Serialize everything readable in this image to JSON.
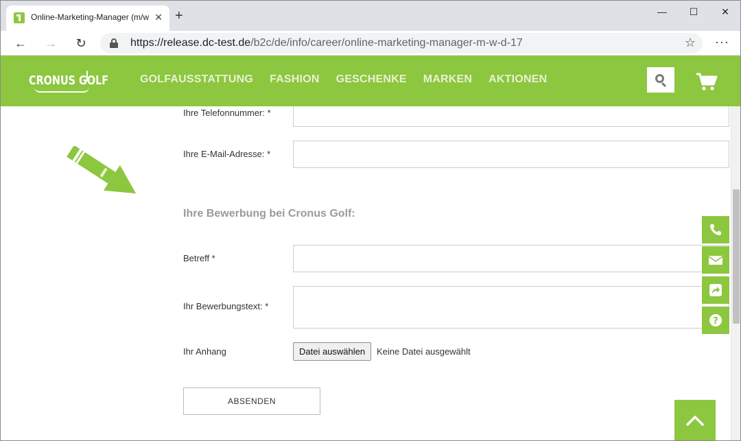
{
  "browser": {
    "tab_title": "Online-Marketing-Manager (m/w",
    "tab_close": "✕",
    "new_tab": "+",
    "url_host": "https://release.dc-test.de",
    "url_path": "/b2c/de/info/career/online-marketing-manager-m-w-d-17",
    "window_minimize": "—",
    "window_maximize": "☐",
    "window_close": "✕",
    "back": "←",
    "forward": "→",
    "reload": "↻",
    "favorite": "☆",
    "menu": "···"
  },
  "site": {
    "logo_text": "CRONUS GOLF",
    "brand_color": "#8dc63f",
    "nav": [
      "GOLFAUSSTATTUNG",
      "FASHION",
      "GESCHENKE",
      "MARKEN",
      "AKTIONEN"
    ]
  },
  "form": {
    "phone_label": "Ihre Telefonnummer: *",
    "email_label": "Ihre E-Mail-Adresse: *",
    "section_title": "Ihre Bewerbung bei Cronus Golf:",
    "subject_label": "Betreff *",
    "text_label": "Ihr Bewerbungstext: *",
    "attachment_label": "Ihr Anhang",
    "file_button": "Datei auswählen",
    "file_status": "Keine Datei ausgewählt",
    "submit": "ABSENDEN"
  },
  "side_buttons": [
    "phone-icon",
    "mail-icon",
    "share-icon",
    "help-icon"
  ]
}
